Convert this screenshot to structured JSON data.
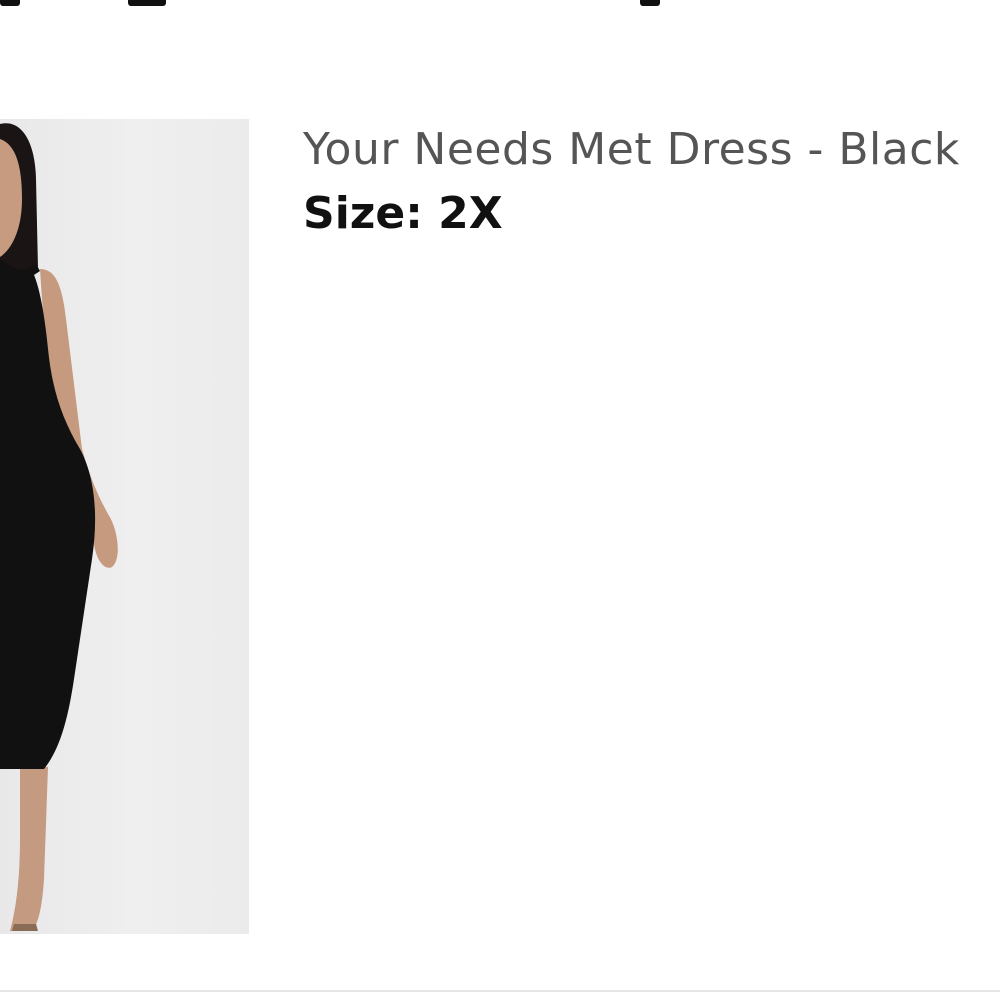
{
  "item": {
    "title": "Your Needs Met Dress - Black",
    "size_label": "Size:",
    "size_value": "2X",
    "image_icon": "product-photo-dress"
  },
  "colors": {
    "title_text": "#555555",
    "size_text": "#111111",
    "divider": "#e6e6e6",
    "image_bg": "#eeedee"
  }
}
